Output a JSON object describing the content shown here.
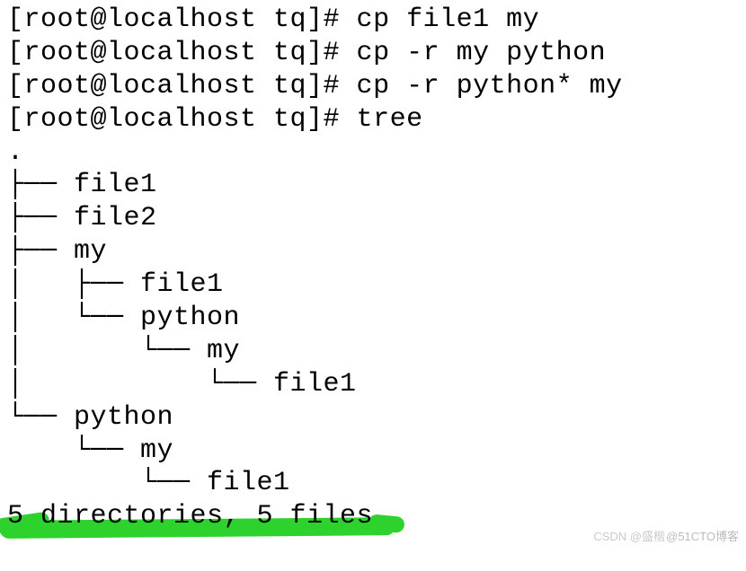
{
  "lines": {
    "l0": "[root@localhost tq]# cp file1 my",
    "l1": "[root@localhost tq]# cp -r my python",
    "l2": "[root@localhost tq]# cp -r python* my",
    "l3": "[root@localhost tq]# tree",
    "l4": ".",
    "l5": "├── file1",
    "l6": "├── file2",
    "l7": "├── my",
    "l8": "│   ├── file1",
    "l9": "│   └── python",
    "l10": "│       └── my",
    "l11": "│           └── file1",
    "l12": "└── python",
    "l13": "    └── my",
    "l14": "        └── file1",
    "l15": "",
    "l16": "5 directories, 5 files"
  },
  "watermark": {
    "w1": "@51CTO博客",
    "w2": "CSDN @盛楷"
  }
}
